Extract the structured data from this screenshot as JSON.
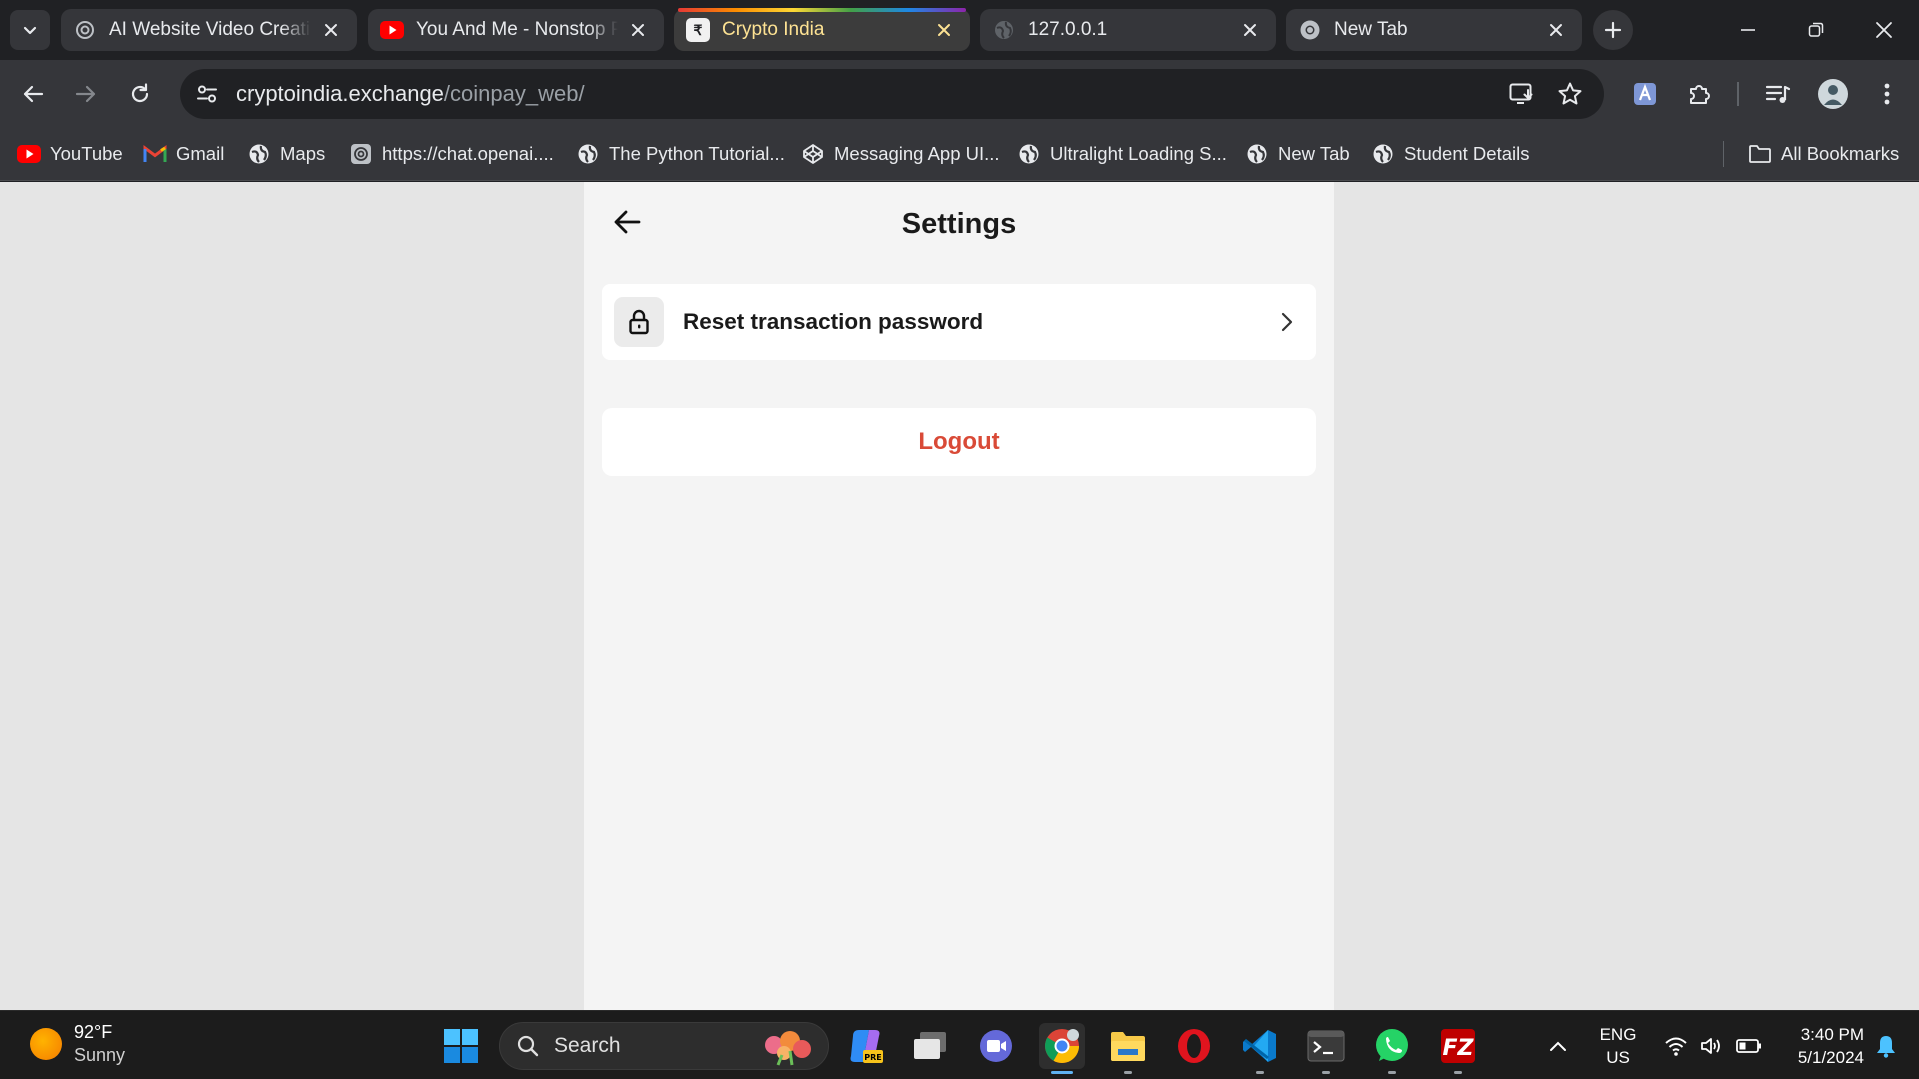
{
  "tabs": [
    {
      "title": "AI Website Video Creation",
      "favicon": "chatgpt-icon",
      "active": false
    },
    {
      "title": "You And Me - Nonstop Party",
      "favicon": "youtube-icon",
      "active": false
    },
    {
      "title": "Crypto India",
      "favicon": "rupee-icon",
      "active": true
    },
    {
      "title": "127.0.0.1",
      "favicon": "globe-icon",
      "active": false
    },
    {
      "title": "New Tab",
      "favicon": "chrome-icon",
      "active": false
    }
  ],
  "address_bar": {
    "host": "cryptoindia.exchange",
    "path": "/coinpay_web/"
  },
  "bookmarks": [
    {
      "label": "YouTube",
      "icon": "youtube-icon"
    },
    {
      "label": "Gmail",
      "icon": "gmail-icon"
    },
    {
      "label": "Maps",
      "icon": "globe-icon"
    },
    {
      "label": "https://chat.openai....",
      "icon": "chatgpt-icon"
    },
    {
      "label": "The Python Tutorial...",
      "icon": "globe-icon"
    },
    {
      "label": "Messaging App UI...",
      "icon": "codepen-icon"
    },
    {
      "label": "Ultralight Loading S...",
      "icon": "globe-icon"
    },
    {
      "label": "New Tab",
      "icon": "globe-icon"
    },
    {
      "label": "Student Details",
      "icon": "globe-icon"
    }
  ],
  "all_bookmarks_label": "All Bookmarks",
  "page": {
    "title": "Settings",
    "reset_label": "Reset transaction password",
    "logout_label": "Logout"
  },
  "taskbar": {
    "weather_temp": "92°F",
    "weather_desc": "Sunny",
    "search_label": "Search",
    "lang_1": "ENG",
    "lang_2": "US",
    "time": "3:40 PM",
    "date": "5/1/2024"
  },
  "colors": {
    "accent_logout": "#d94a37",
    "chrome_dark": "#202124",
    "toolbar": "#35363a",
    "active_tab_text": "#fde293"
  }
}
